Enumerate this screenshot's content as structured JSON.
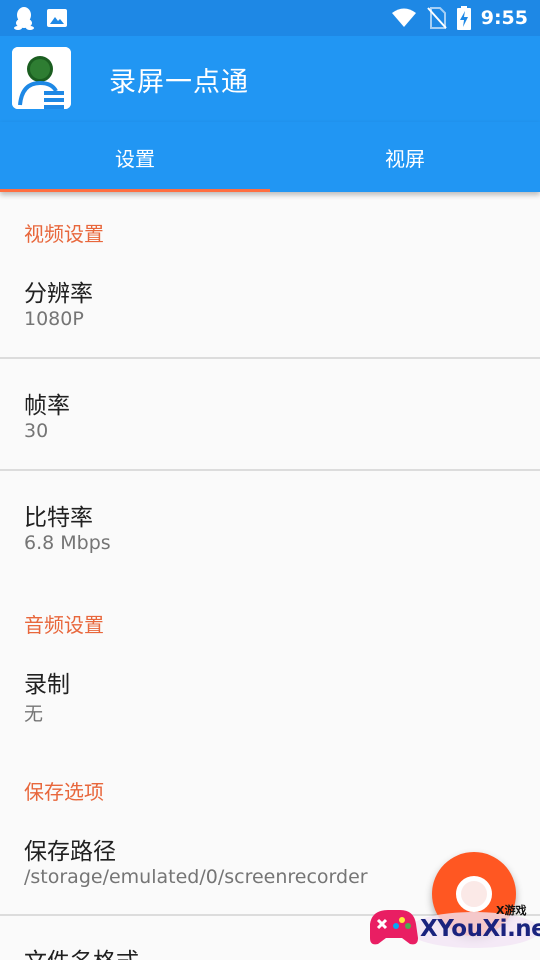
{
  "status_bar": {
    "time": "9:55",
    "icons": [
      "qq-icon",
      "image-icon",
      "wifi-icon",
      "no-sim-icon",
      "battery-charging-icon"
    ]
  },
  "app": {
    "title": "录屏一点通"
  },
  "tabs": [
    {
      "label": "设置",
      "active": true
    },
    {
      "label": "视屏",
      "active": false
    }
  ],
  "sections": {
    "video": "视频设置",
    "audio": "音频设置",
    "save": "保存选项"
  },
  "prefs": {
    "resolution": {
      "title": "分辨率",
      "summary": "1080P"
    },
    "framerate": {
      "title": "帧率",
      "summary": "30"
    },
    "bitrate": {
      "title": "比特率",
      "summary": "6.8 Mbps"
    },
    "record": {
      "title": "录制",
      "summary": "无"
    },
    "save_path": {
      "title": "保存路径",
      "summary": "/storage/emulated/0/screenrecorder"
    },
    "filename": {
      "title": "文件名格式"
    }
  },
  "watermark": {
    "text": "XYouXi.net",
    "small": "X游戏"
  },
  "colors": {
    "status_bar": "#1e88e5",
    "primary": "#2196f3",
    "accent": "#ff6e40",
    "section_header": "#e8673c",
    "fab": "#ff5722"
  }
}
